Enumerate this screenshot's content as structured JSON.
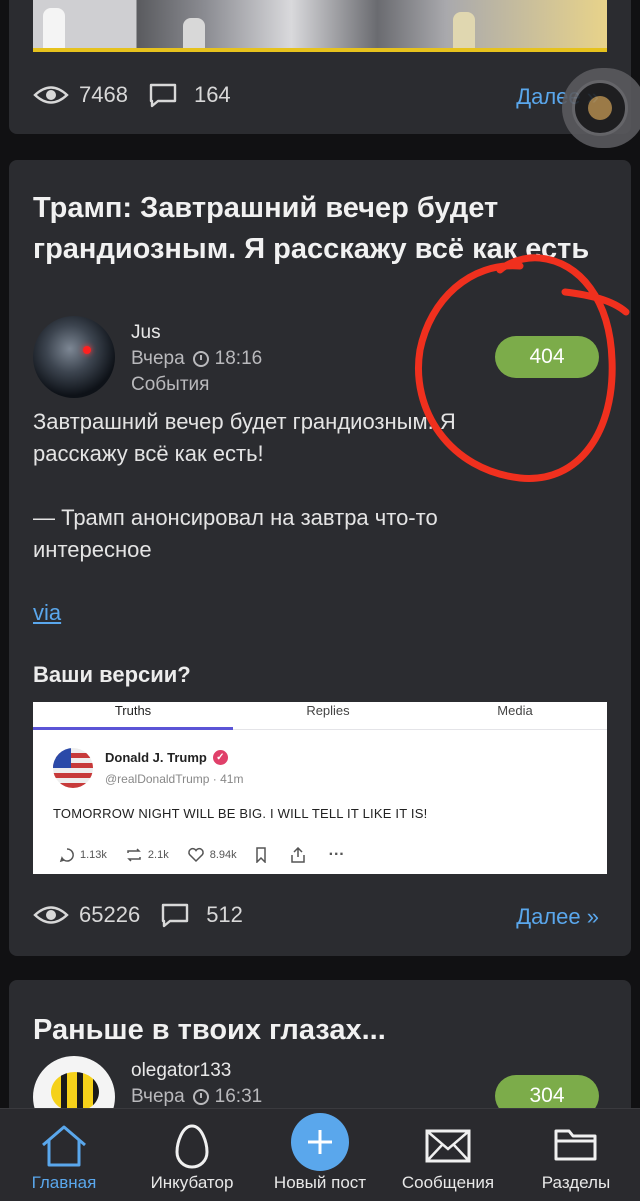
{
  "top_card": {
    "views": "7468",
    "comments": "164",
    "more": "Далее »"
  },
  "post": {
    "title": "Трамп: Завтрашний вечер будет грандиозным. Я расскажу всё как есть",
    "author": "Jus",
    "date": "Вчера",
    "time": "18:16",
    "category": "События",
    "rating": "404",
    "text1_line1": "Завтрашний вечер будет грандиозным. Я",
    "text1_line2": "расскажу всё как есть!",
    "text2_line1": "— Трамп анонсировал на завтра что-то",
    "text2_line2": "интересное",
    "via": "via",
    "question": "Ваши версии?",
    "views": "65226",
    "comments": "512",
    "more": "Далее »"
  },
  "embed": {
    "tabs": [
      "Truths",
      "Replies",
      "Media"
    ],
    "name": "Donald J. Trump",
    "handle": "@realDonaldTrump · 41m",
    "text": "TOMORROW NIGHT WILL BE BIG. I WILL TELL IT LIKE IT IS!",
    "replies": "1.13k",
    "retruths": "2.1k",
    "likes": "8.94k"
  },
  "next_post": {
    "title": "Раньше в твоих глазах...",
    "author": "olegator133",
    "date": "Вчера",
    "time": "16:31",
    "rating": "304"
  },
  "nav": {
    "home": "Главная",
    "incubator": "Инкубатор",
    "new_post": "Новый пост",
    "messages": "Сообщения",
    "sections": "Разделы"
  },
  "colors": {
    "accent": "#5aa7ec",
    "badge_green": "#7cac4a",
    "annotation_red": "#f0301e",
    "card_bg": "#2b2c30"
  }
}
